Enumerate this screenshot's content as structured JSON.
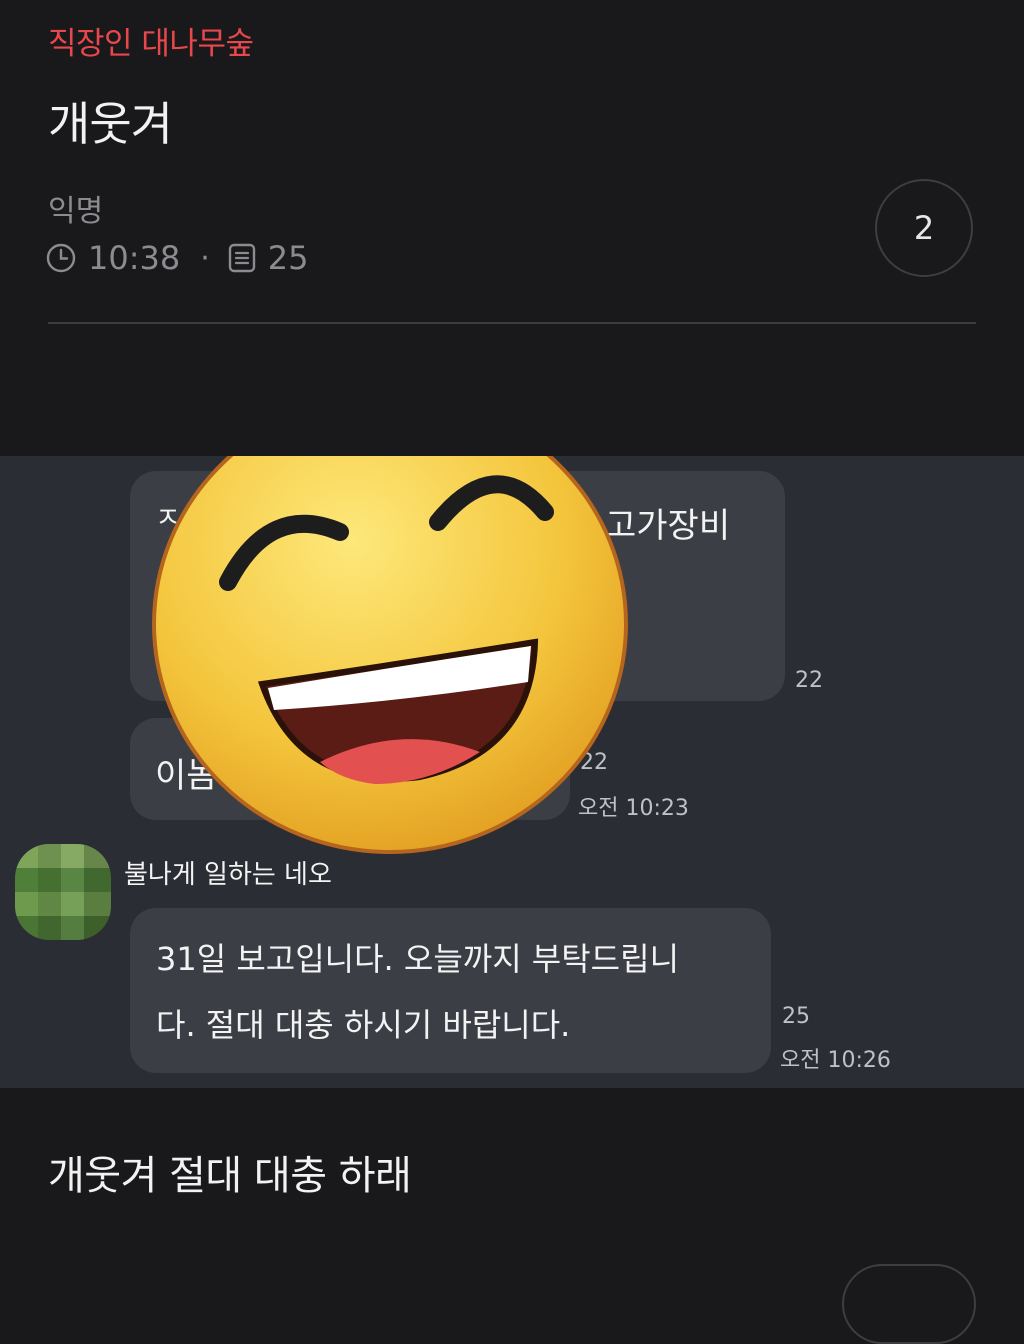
{
  "board": "직장인 대나무숲",
  "post": {
    "title": "개웃겨",
    "author": "익명",
    "time": "10:38",
    "views": "25",
    "comment_count": "2",
    "body_text": "개웃겨 절대 대충 하래"
  },
  "screenshot": {
    "bubble1_partial_left": "ㅈ",
    "bubble1_partial_right": "고가장비",
    "bubble1_read_count": "22",
    "bubble2_partial": "이놈",
    "bubble2_read_count": "22",
    "bubble2_time": "오전 10:23",
    "sender_name": "불나게 일하는 네오",
    "message_line1": "31일 보고입니다. 오늘까지 부탁드립니",
    "message_line2": "다. 절대 대충 하시기 바랍니다.",
    "message_read_count": "25",
    "message_time": "오전 10:26"
  },
  "colors": {
    "background": "#19191b",
    "board_accent": "#e8474c",
    "muted_text": "#8c8c90",
    "chat_background": "#2a2d33",
    "bubble": "#3b3e44"
  },
  "icons": {
    "time": "clock-icon",
    "views": "document-icon",
    "sticker": "laughing-face-emoji"
  }
}
